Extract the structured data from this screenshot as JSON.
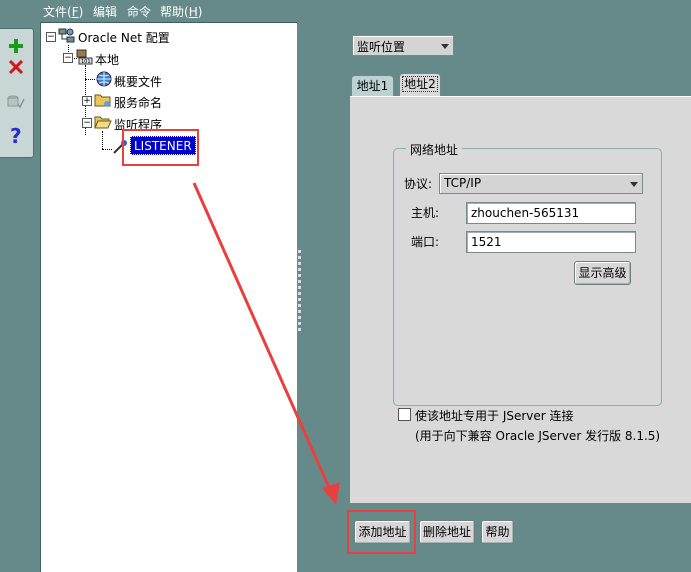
{
  "menu": [
    {
      "label": "文件(",
      "accel": "F",
      "tail": ")"
    },
    {
      "label": "编辑",
      "accel": "",
      "tail": ""
    },
    {
      "label": "命令",
      "accel": "",
      "tail": ""
    },
    {
      "label": "帮助(",
      "accel": "H",
      "tail": ")"
    }
  ],
  "toolbar": {
    "add_icon": "plus-icon",
    "delete_icon": "x-icon",
    "test_icon": "test-icon",
    "help_icon": "question-icon"
  },
  "tree": {
    "root": "Oracle Net 配置",
    "local": "本地",
    "profile": "概要文件",
    "naming": "服务命名",
    "listeners": "监听程序",
    "listener": "LISTENER"
  },
  "right": {
    "view_select": "监听位置",
    "tabs": [
      "地址1",
      "地址2"
    ],
    "active_tab": 1,
    "group_title": "网络地址",
    "protocol_label": "协议:",
    "protocol_value": "TCP/IP",
    "host_label": "主机:",
    "host_value": "zhouchen-565131",
    "port_label": "端口:",
    "port_value": "1521",
    "advanced_button": "显示高级",
    "checkbox_label": "使该地址专用于 JServer 连接",
    "checkbox_note": "(用于向下兼容 Oracle JServer 发行版 8.1.5)",
    "checkbox_checked": false
  },
  "buttons": {
    "add_address": "添加地址",
    "delete_address": "删除地址",
    "help": "帮助"
  },
  "colors": {
    "background": "#668a8a",
    "panel": "#d9d9d9",
    "selection": "#0000cc",
    "annotation": "#e8403f"
  }
}
